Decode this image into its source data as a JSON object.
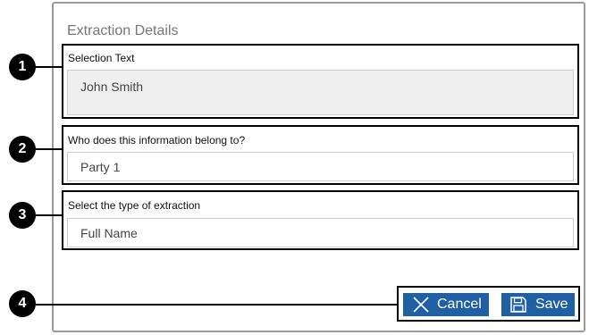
{
  "dialog": {
    "title": "Extraction Details",
    "fields": [
      {
        "marker": "1",
        "label": "Selection Text",
        "value": "John Smith"
      },
      {
        "marker": "2",
        "label": "Who does this information belong to?",
        "value": "Party 1"
      },
      {
        "marker": "3",
        "label": "Select the type of extraction",
        "value": "Full Name"
      }
    ],
    "actions": {
      "marker": "4",
      "cancel_label": "Cancel",
      "save_label": "Save",
      "cancel_icon": "close-icon",
      "save_icon": "floppy-disk-icon"
    }
  },
  "colors": {
    "button": "#1f5fa3",
    "readonly_background": "#efefef",
    "title_text": "#777777"
  }
}
